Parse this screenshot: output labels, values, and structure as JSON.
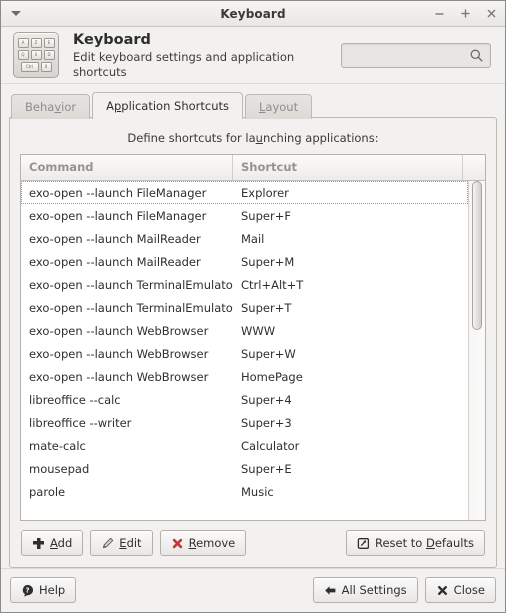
{
  "window": {
    "title": "Keyboard",
    "menu_icon": "chevron-down-icon",
    "minimize_label": "−",
    "maximize_label": "+",
    "close_label": "×"
  },
  "header": {
    "title": "Keyboard",
    "subtitle": "Edit keyboard settings and application shortcuts",
    "icon_keys": [
      "A",
      "Z",
      "E",
      "Q",
      "S",
      "D",
      "Ctrl",
      "0"
    ],
    "search": {
      "value": "",
      "placeholder": ""
    }
  },
  "tabs": [
    {
      "label": "Behavior",
      "mnemonic_index": 4,
      "active": false
    },
    {
      "label": "Application Shortcuts",
      "mnemonic_index": 1,
      "active": true
    },
    {
      "label": "Layout",
      "mnemonic_index": 0,
      "active": false
    }
  ],
  "panel": {
    "label_before": "Define shortcuts for la",
    "label_mnemonic": "u",
    "label_after": "nching applications:"
  },
  "table": {
    "columns": [
      "Command",
      "Shortcut"
    ],
    "focused_row_index": 0,
    "rows": [
      {
        "command": "exo-open --launch FileManager",
        "shortcut": "Explorer"
      },
      {
        "command": "exo-open --launch FileManager",
        "shortcut": "Super+F"
      },
      {
        "command": "exo-open --launch MailReader",
        "shortcut": "Mail"
      },
      {
        "command": "exo-open --launch MailReader",
        "shortcut": "Super+M"
      },
      {
        "command": "exo-open --launch TerminalEmulator",
        "shortcut": "Ctrl+Alt+T"
      },
      {
        "command": "exo-open --launch TerminalEmulator",
        "shortcut": "Super+T"
      },
      {
        "command": "exo-open --launch WebBrowser",
        "shortcut": "WWW"
      },
      {
        "command": "exo-open --launch WebBrowser",
        "shortcut": "Super+W"
      },
      {
        "command": "exo-open --launch WebBrowser",
        "shortcut": "HomePage"
      },
      {
        "command": "libreoffice --calc",
        "shortcut": "Super+4"
      },
      {
        "command": "libreoffice --writer",
        "shortcut": "Super+3"
      },
      {
        "command": "mate-calc",
        "shortcut": "Calculator"
      },
      {
        "command": "mousepad",
        "shortcut": "Super+E"
      },
      {
        "command": "parole",
        "shortcut": "Music"
      }
    ],
    "scrollbar": {
      "thumb_top_pct": 0,
      "thumb_height_pct": 44
    }
  },
  "actions": {
    "add": {
      "label_before": "",
      "mnemonic": "A",
      "label_after": "dd",
      "icon": "plus-icon"
    },
    "edit": {
      "label_before": "",
      "mnemonic": "E",
      "label_after": "dit",
      "icon": "pencil-icon"
    },
    "remove": {
      "label_before": "",
      "mnemonic": "R",
      "label_after": "emove",
      "icon": "red-x-icon"
    },
    "reset": {
      "label_before": "Reset to ",
      "mnemonic": "D",
      "label_after": "efaults",
      "icon": "reset-icon"
    }
  },
  "bottom": {
    "help": {
      "label": "Help",
      "icon": "help-icon"
    },
    "all_settings": {
      "label": "All Settings",
      "icon": "back-arrow-icon"
    },
    "close": {
      "label": "Close",
      "icon": "close-x-icon"
    }
  },
  "colors": {
    "window_bg": "#f2f1f0",
    "accent_red": "#c6362f",
    "text": "#2f2f2d",
    "header_muted": "#96938e"
  }
}
